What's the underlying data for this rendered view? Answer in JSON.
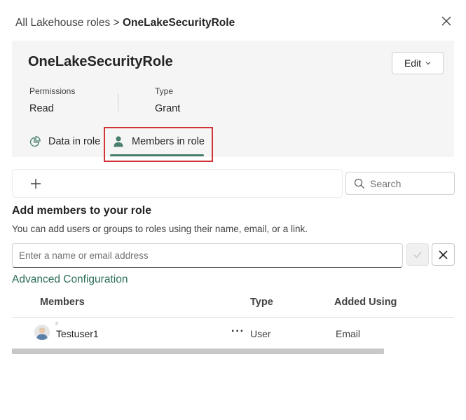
{
  "breadcrumb": {
    "parent": "All Lakehouse roles",
    "separator": ">",
    "current": "OneLakeSecurityRole"
  },
  "header": {
    "title": "OneLakeSecurityRole",
    "edit_label": "Edit",
    "permissions_label": "Permissions",
    "permissions_value": "Read",
    "type_label": "Type",
    "type_value": "Grant"
  },
  "tabs": [
    {
      "label": "Data in role",
      "icon": "pie-chart-icon",
      "selected": false
    },
    {
      "label": "Members in role",
      "icon": "person-icon",
      "selected": true
    }
  ],
  "toolbar": {
    "add_icon": "plus-icon",
    "search_placeholder": "Search"
  },
  "add_members": {
    "title": "Add members to your role",
    "description": "You can add users or groups to roles using their name, email, or a link.",
    "input_placeholder": "Enter a name or email address",
    "advanced_link": "Advanced Configuration"
  },
  "table": {
    "columns": [
      "Members",
      "Type",
      "Added Using"
    ],
    "rows": [
      {
        "name": "Testuser1",
        "more": "···",
        "type": "User",
        "added_using": "Email"
      }
    ]
  },
  "colors": {
    "accent": "#4a7f6c",
    "link": "#2c6e5a",
    "highlight": "#d13438",
    "panel": "#f5f5f5"
  }
}
